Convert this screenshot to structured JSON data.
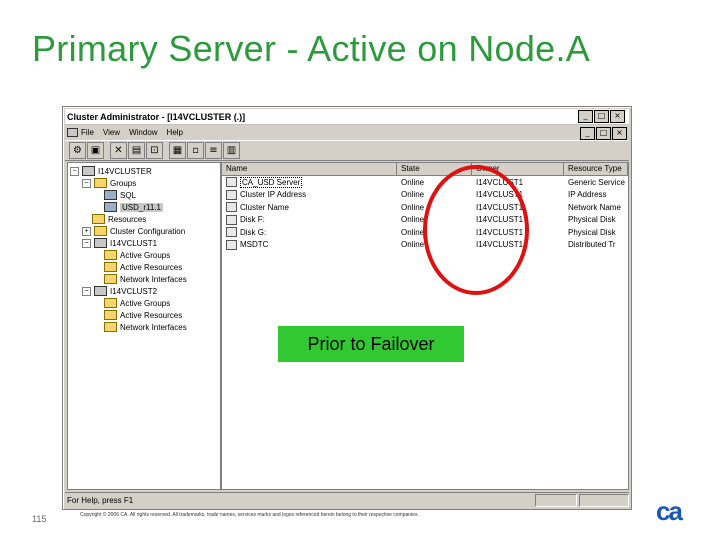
{
  "slide": {
    "title": "Primary Server -  Active on Node.A",
    "page_number": "115",
    "copyright": "Copyright © 2006 CA. All rights reserved. All trademarks, trade names, services marks and logos referenced herein belong to their respective companies.",
    "logo_text": "ca",
    "callout": "Prior to Failover",
    "highlight_color": "#e01010",
    "title_color": "#2e9a3e",
    "callout_color": "#32c832"
  },
  "window": {
    "title": "Cluster Administrator - [I14VCLUSTER (.)]",
    "buttons": [
      "_",
      "□",
      "×"
    ],
    "menu": [
      "File",
      "View",
      "Window",
      "Help"
    ],
    "toolbar_icons": [
      "properties-icon",
      "new-icon",
      "delete-icon",
      "bring-online-icon",
      "take-offline-icon",
      "large-icons-icon",
      "small-icons-icon",
      "list-icon",
      "details-icon"
    ],
    "status": "For Help, press F1"
  },
  "tree": [
    {
      "label": "I14VCLUSTER",
      "icon": "cluster-icon"
    },
    {
      "label": "Groups",
      "icon": "folder-icon"
    },
    {
      "label": "SQL",
      "icon": "group-icon"
    },
    {
      "label": "USD_r11.1",
      "icon": "group-icon",
      "selected": true
    },
    {
      "label": "Resources",
      "icon": "folder-icon"
    },
    {
      "label": "Cluster Configuration",
      "icon": "folder-icon"
    },
    {
      "label": "I14VCLUST1",
      "icon": "server-icon"
    },
    {
      "label": "Active Groups",
      "icon": "folder-icon"
    },
    {
      "label": "Active Resources",
      "icon": "folder-icon"
    },
    {
      "label": "Network Interfaces",
      "icon": "folder-icon"
    },
    {
      "label": "I14VCLUST2",
      "icon": "server-icon"
    },
    {
      "label": "Active Groups",
      "icon": "folder-icon"
    },
    {
      "label": "Active Resources",
      "icon": "folder-icon"
    },
    {
      "label": "Network Interfaces",
      "icon": "folder-icon"
    }
  ],
  "list": {
    "columns": [
      "Name",
      "State",
      "Owner",
      "Resource Type"
    ],
    "rows": [
      {
        "name": "CA_USD Server",
        "state": "Online",
        "owner": "I14VCLUST1",
        "type": "Generic Service"
      },
      {
        "name": "Cluster IP Address",
        "state": "Online",
        "owner": "I14VCLUST1",
        "type": "IP Address"
      },
      {
        "name": "Cluster Name",
        "state": "Online",
        "owner": "I14VCLUST1",
        "type": "Network Name"
      },
      {
        "name": "Disk F:",
        "state": "Online",
        "owner": "I14VCLUST1",
        "type": "Physical Disk"
      },
      {
        "name": "Disk G:",
        "state": "Online",
        "owner": "I14VCLUST1",
        "type": "Physical Disk"
      },
      {
        "name": "MSDTC",
        "state": "Online",
        "owner": "I14VCLUST1",
        "type": "Distributed Tr"
      }
    ]
  }
}
